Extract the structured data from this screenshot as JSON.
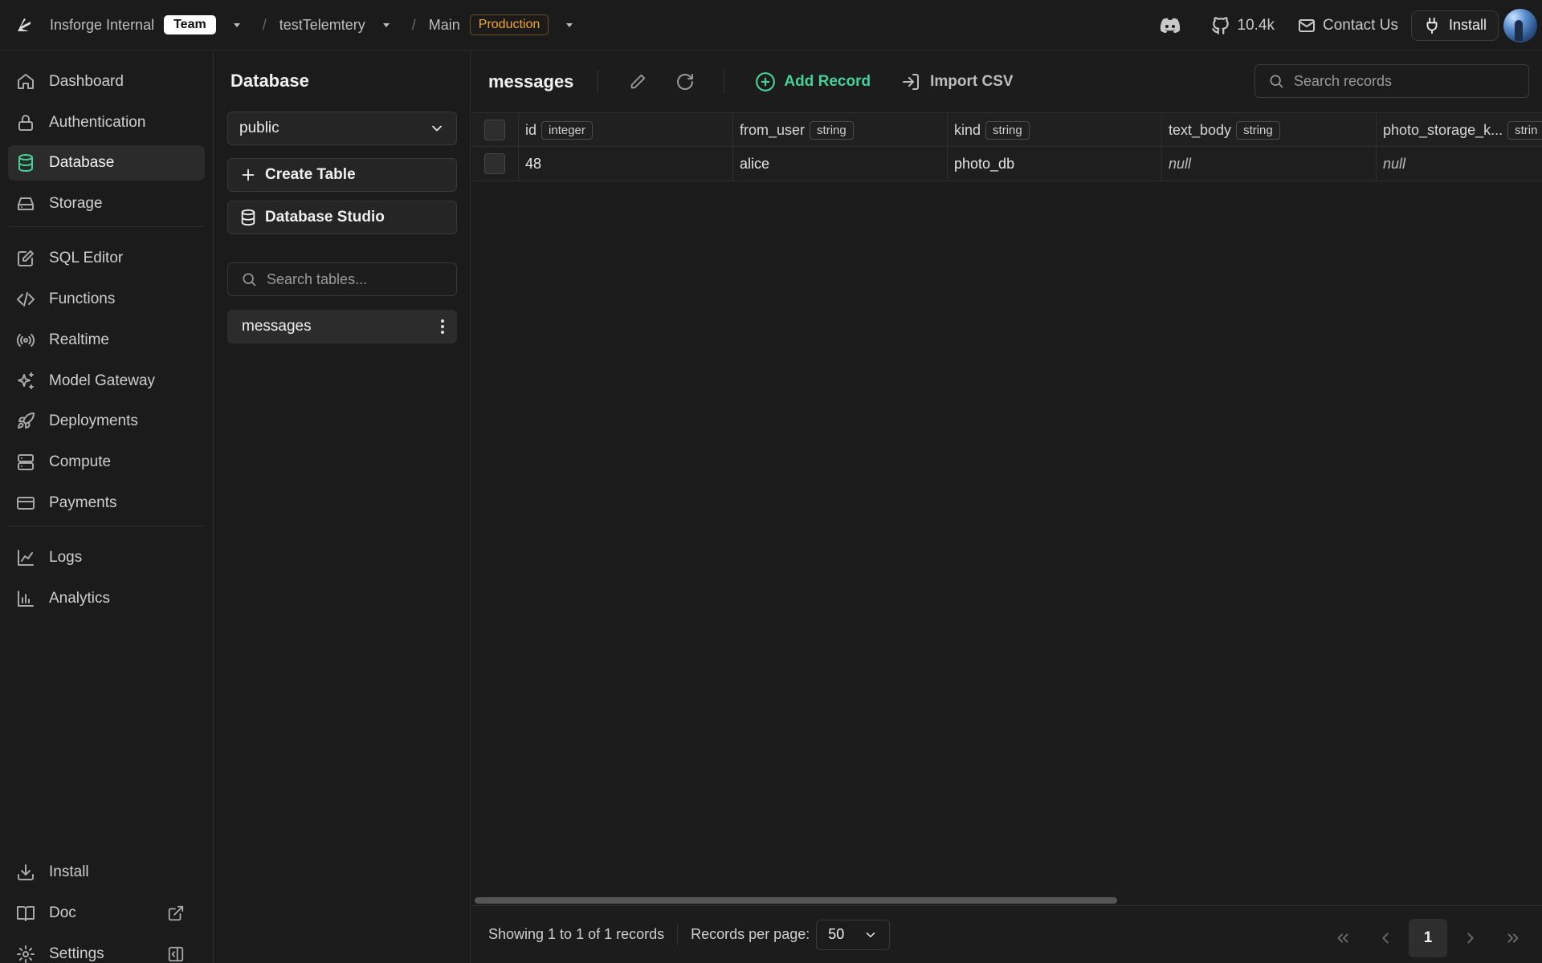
{
  "topbar": {
    "org": "Insforge Internal",
    "org_badge": "Team",
    "project": "testTelemtery",
    "branch": "Main",
    "env_badge": "Production",
    "github_stars": "10.4k",
    "contact": "Contact Us",
    "install": "Install"
  },
  "sidebar": {
    "items": [
      {
        "label": "Dashboard",
        "icon": "home-icon"
      },
      {
        "label": "Authentication",
        "icon": "lock-icon"
      },
      {
        "label": "Database",
        "icon": "database-icon",
        "active": true
      },
      {
        "label": "Storage",
        "icon": "hard-drive-icon"
      },
      {
        "label": "SQL Editor",
        "icon": "edit-icon"
      },
      {
        "label": "Functions",
        "icon": "code-icon"
      },
      {
        "label": "Realtime",
        "icon": "radio-icon"
      },
      {
        "label": "Model Gateway",
        "icon": "sparkles-icon"
      },
      {
        "label": "Deployments",
        "icon": "rocket-icon"
      },
      {
        "label": "Compute",
        "icon": "server-icon"
      },
      {
        "label": "Payments",
        "icon": "credit-card-icon"
      },
      {
        "label": "Logs",
        "icon": "line-chart-icon"
      },
      {
        "label": "Analytics",
        "icon": "bar-chart-icon"
      }
    ],
    "bottom": [
      {
        "label": "Install",
        "icon": "download-icon"
      },
      {
        "label": "Doc",
        "icon": "book-icon"
      },
      {
        "label": "Settings",
        "icon": "gear-icon"
      }
    ]
  },
  "dbpanel": {
    "title": "Database",
    "schema": "public",
    "create_table": "Create Table",
    "studio": "Database Studio",
    "search_placeholder": "Search tables...",
    "tables": [
      "messages"
    ]
  },
  "main": {
    "table_name": "messages",
    "add_record": "Add Record",
    "import_csv": "Import CSV",
    "search_placeholder": "Search records",
    "columns": [
      {
        "name": "id",
        "type": "integer"
      },
      {
        "name": "from_user",
        "type": "string"
      },
      {
        "name": "kind",
        "type": "string"
      },
      {
        "name": "text_body",
        "type": "string"
      },
      {
        "name": "photo_storage_k...",
        "type": "strin"
      }
    ],
    "rows": [
      [
        "48",
        "alice",
        "photo_db",
        "null",
        "null"
      ]
    ],
    "footer": {
      "showing": "Showing 1 to 1 of 1 records",
      "per_page_label": "Records per page:",
      "per_page": "50",
      "current_page": "1"
    }
  },
  "colors": {
    "accent": "#46d19a",
    "production": "#f0a829"
  }
}
